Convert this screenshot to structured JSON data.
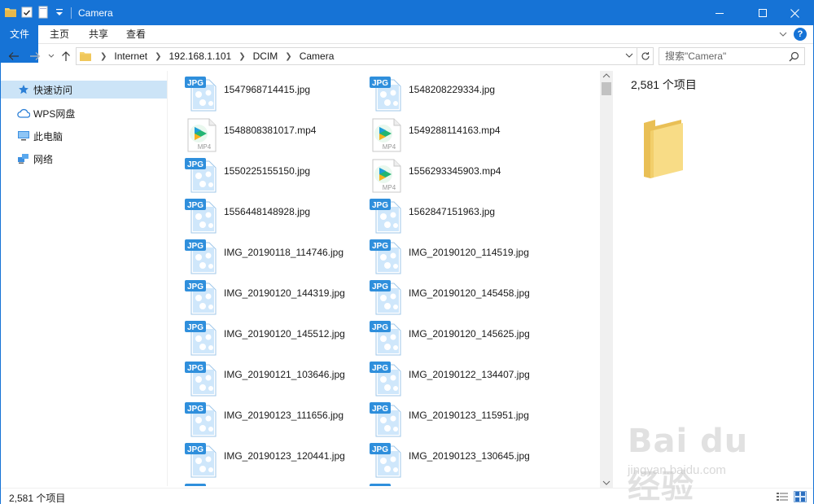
{
  "window": {
    "title": "Camera",
    "accent": "#1673d6"
  },
  "ribbon": {
    "tabs": [
      "文件",
      "主页",
      "共享",
      "查看"
    ]
  },
  "address": {
    "crumbs": [
      "Internet",
      "192.168.1.101",
      "DCIM",
      "Camera"
    ]
  },
  "search": {
    "placeholder": "搜索\"Camera\""
  },
  "sidebar": {
    "items": [
      {
        "label": "快速访问",
        "icon": "star-icon"
      },
      {
        "label": "WPS网盘",
        "icon": "cloud-icon"
      },
      {
        "label": "此电脑",
        "icon": "computer-icon"
      },
      {
        "label": "网络",
        "icon": "network-icon"
      }
    ]
  },
  "files": [
    {
      "name": "1547968714415.jpg",
      "type": "jpg"
    },
    {
      "name": "1548208229334.jpg",
      "type": "jpg"
    },
    {
      "name": "1548808381017.mp4",
      "type": "mp4"
    },
    {
      "name": "1549288114163.mp4",
      "type": "mp4"
    },
    {
      "name": "1550225155150.jpg",
      "type": "jpg"
    },
    {
      "name": "1556293345903.mp4",
      "type": "mp4"
    },
    {
      "name": "1556448148928.jpg",
      "type": "jpg"
    },
    {
      "name": "1562847151963.jpg",
      "type": "jpg"
    },
    {
      "name": "IMG_20190118_114746.jpg",
      "type": "jpg"
    },
    {
      "name": "IMG_20190120_114519.jpg",
      "type": "jpg"
    },
    {
      "name": "IMG_20190120_144319.jpg",
      "type": "jpg"
    },
    {
      "name": "IMG_20190120_145458.jpg",
      "type": "jpg"
    },
    {
      "name": "IMG_20190120_145512.jpg",
      "type": "jpg"
    },
    {
      "name": "IMG_20190120_145625.jpg",
      "type": "jpg"
    },
    {
      "name": "IMG_20190121_103646.jpg",
      "type": "jpg"
    },
    {
      "name": "IMG_20190122_134407.jpg",
      "type": "jpg"
    },
    {
      "name": "IMG_20190123_111656.jpg",
      "type": "jpg"
    },
    {
      "name": "IMG_20190123_115951.jpg",
      "type": "jpg"
    },
    {
      "name": "IMG_20190123_120441.jpg",
      "type": "jpg"
    },
    {
      "name": "IMG_20190123_130645.jpg",
      "type": "jpg"
    }
  ],
  "preview": {
    "count": "2,581 个项目"
  },
  "status": {
    "count": "2,581 个项目"
  },
  "watermark": {
    "logo": "Bai du 经验",
    "url": "jingyan.baidu.com"
  }
}
